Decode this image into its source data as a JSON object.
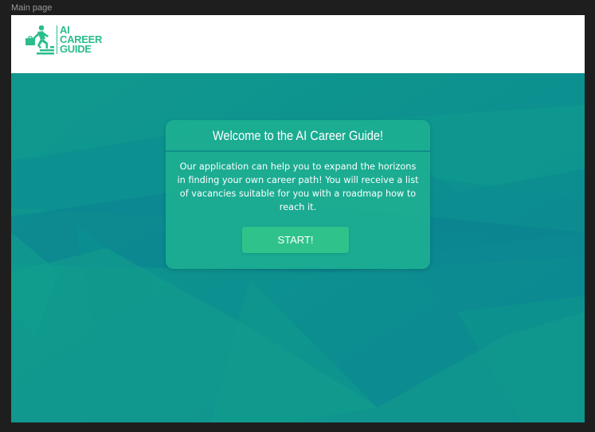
{
  "frame": {
    "label": "Main page"
  },
  "header": {
    "logo": {
      "icon": "running-man-briefcase-stairs-icon",
      "line1": "AI",
      "line2": "CAREER",
      "line3": "GUIDE",
      "color": "#2bbd8c"
    }
  },
  "welcome_card": {
    "title": "Welcome to the AI Career Guide!",
    "body": "Our application can help you to expand the horizons in finding your own career path! You will receive a list of vacancies suitable for you with a roadmap how to reach it.",
    "start_label": "START!"
  },
  "colors": {
    "accent": "#2bbd8c",
    "hero_background": "#0e8f8c",
    "button": "#2fc38b"
  }
}
